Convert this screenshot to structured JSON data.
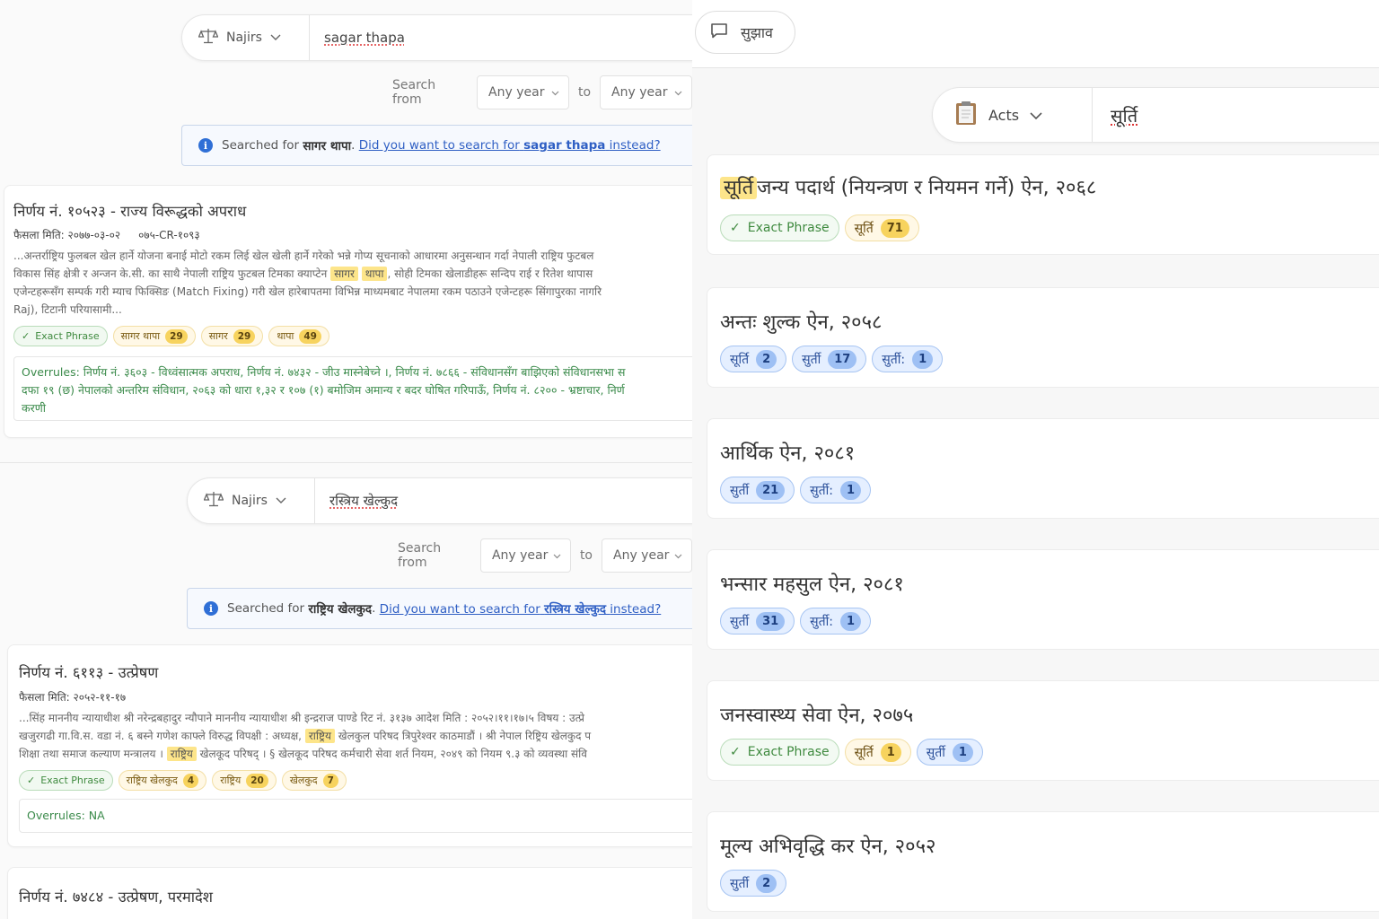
{
  "left": {
    "block1": {
      "search_type": "Najirs",
      "query": "sagar thapa",
      "year_from_label": "Search from",
      "year_from": "Any year",
      "year_to_label": "to",
      "year_to": "Any year",
      "notice_prefix": "Searched for",
      "notice_term": "सागर थापा",
      "notice_link_prefix": "Did you want to search for",
      "notice_link_term": "sagar thapa",
      "notice_link_suffix": "instead?",
      "result": {
        "title": "निर्णय नं. १०५२३ - राज्य विरूद्धको अपराध",
        "date": "फैसला मिति: २०७७-०३-०२",
        "code": "०७५-CR-१०९३",
        "line1": "...अन्तर्राष्ट्रिय फुलबल खेल हार्ने योजना बनाई मोटो रकम लिई खेल खेली हार्ने गरेको भन्ने गोप्य सूचनाको आधारमा अनुसन्धान गर्दा नेपाली राष्ट्रिय फुटबल",
        "line2_a": "विकास सिंह क्षेत्री र अन्जन के.सी. का साथै नेपाली राष्ट्रिय फुटबल टिमका क्याप्टेन",
        "line2_hl1": "सागर",
        "line2_hl2": "थापा",
        "line2_b": ", सोही टिमका खेलाडीहरू सन्दिप राई र रितेश थापास",
        "line3": "एजेन्टहरूसँग सम्पर्क गरी म्याच फिक्सिङ (Match Fixing) गरी खेल हारेबापतमा विभिन्न माध्यमबाट नेपालमा रकम पठाउने एजेन्टहरू सिंगापुरका नागरि",
        "line4": "Raj), टिटानी परियासामी...",
        "chips": [
          {
            "label": "Exact Phrase",
            "kind": "exact"
          },
          {
            "label": "सागर थापा",
            "count": "29",
            "kind": "term"
          },
          {
            "label": "सागर",
            "count": "29",
            "kind": "term"
          },
          {
            "label": "थापा",
            "count": "49",
            "kind": "term"
          }
        ],
        "overrules_label": "Overrules:",
        "overrules_text1": "निर्णय नं. ३६०३ - विध्वंसात्मक अपराध, निर्णय नं. ७४३२ - जीउ मास्नेबेच्ने ।, निर्णय नं. ७८६६ - संविधानसँग बाझिएको संविधानसभा स",
        "overrules_text2": "दफा १९ (छ) नेपालको अन्तरिम संविधान, २०६३ को धारा १,३२ र १०७ (१) बमोजिम अमान्य र बदर घोषित गरिपाऊँ, निर्णय नं. ८२०० - भ्रष्टाचार, निर्ण",
        "overrules_text3": "करणी"
      }
    },
    "block2": {
      "search_type": "Najirs",
      "query": "रस्त्रिय खेल्कुद",
      "year_from_label": "Search from",
      "year_from": "Any year",
      "year_to_label": "to",
      "year_to": "Any year",
      "notice_prefix": "Searched for",
      "notice_term": "राष्ट्रिय खेलकुद",
      "notice_link_prefix": "Did you want to search for",
      "notice_link_term": "रस्त्रिय खेल्कुद",
      "notice_link_suffix": "instead?",
      "result": {
        "title": "निर्णय नं. ६११३ - उत्प्रेषण",
        "date": "फैसला मिति: २०५२-११-१७",
        "line1": "...सिंह माननीय न्यायाधीश श्री नरेन्द्रबहादुर न्यौपाने माननीय न्यायाधीश श्री इन्द्रराज पाण्डे रिट नं. ३१३७ आदेश मिति    : २०५२।११।१७।५ विषय : उत्प्रे",
        "line2_a": "खजुरगढी गा.वि.स. वडा नं. ६ बस्ने गणेश काफ्ले विरुद्ध विपक्षी    : अध्यक्ष,",
        "line2_hl": "राष्ट्रिय",
        "line2_b": "खेलकुल परिषद त्रिपुरेश्वर काठमाडौं । श्री नेपाल रिष्ट्रिय खेलकुद प",
        "line3_a": "शिक्षा तथा समाज कल्याण मन्त्रालय ।",
        "line3_hl": "राष्ट्रिय",
        "line3_b": "खेलकूद परिषद् । §  खेलकूद परिषद कर्मचारी सेवा शर्त नियम, २०४९ को नियम ९.३ को व्यवस्था संवि",
        "chips": [
          {
            "label": "Exact Phrase",
            "kind": "exact"
          },
          {
            "label": "राष्ट्रिय खेलकुद",
            "count": "4",
            "kind": "term"
          },
          {
            "label": "राष्ट्रिय",
            "count": "20",
            "kind": "term"
          },
          {
            "label": "खेलकुद",
            "count": "7",
            "kind": "term"
          }
        ],
        "overrules_label": "Overrules:",
        "overrules_text": "NA"
      },
      "next_title": "निर्णय नं. ७४८४ - उत्प्रेषण, परमादेश"
    }
  },
  "right": {
    "feedback_label": "सुझाव",
    "search_type": "Acts",
    "query": "सूर्ति",
    "results": [
      {
        "title_hl": "सूर्ति",
        "title": "जन्य पदार्थ (नियन्त्रण र नियमन गर्ने) ऐन, २०६८",
        "chips": [
          {
            "label": "Exact Phrase",
            "kind": "exact"
          },
          {
            "label": "सूर्ति",
            "count": "71",
            "kind": "yellow"
          }
        ]
      },
      {
        "title": "अन्तः शुल्क ऐन, २०५८",
        "chips": [
          {
            "label": "सूर्ति",
            "count": "2",
            "kind": "blue"
          },
          {
            "label": "सुर्ती",
            "count": "17",
            "kind": "blue"
          },
          {
            "label": "सुर्ती:",
            "count": "1",
            "kind": "blue"
          }
        ]
      },
      {
        "title": "आर्थिक ऐन, २०८१",
        "chips": [
          {
            "label": "सुर्ती",
            "count": "21",
            "kind": "blue"
          },
          {
            "label": "सुर्ती:",
            "count": "1",
            "kind": "blue"
          }
        ]
      },
      {
        "title": "भन्सार महसुल ऐन, २०८१",
        "chips": [
          {
            "label": "सुर्ती",
            "count": "31",
            "kind": "blue"
          },
          {
            "label": "सुर्ती:",
            "count": "1",
            "kind": "blue"
          }
        ]
      },
      {
        "title": "जनस्वास्थ्य सेवा ऐन, २०७५",
        "chips": [
          {
            "label": "Exact Phrase",
            "kind": "exact"
          },
          {
            "label": "सूर्ति",
            "count": "1",
            "kind": "yellow"
          },
          {
            "label": "सुर्ती",
            "count": "1",
            "kind": "blue"
          }
        ]
      },
      {
        "title": "मूल्य अभिवृद्धि कर ऐन, २०५२",
        "chips": [
          {
            "label": "सुर्ती",
            "count": "2",
            "kind": "blue"
          }
        ]
      }
    ]
  }
}
